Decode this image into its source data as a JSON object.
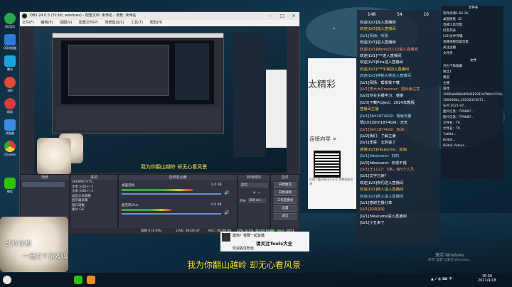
{
  "desktop": {
    "icons": [
      "QQ音乐",
      "QQ浏览器",
      "腾讯",
      "360",
      "网易",
      "浏览器",
      "Chrome",
      "微信"
    ]
  },
  "obs": {
    "title": "OBS 24.0.3 (32-bit, windows) - 配置文件: 未命名 - 场景: 未命名",
    "menu": [
      "文件(F)",
      "编辑(E)",
      "视图(V)",
      "配置文件(P)",
      "场景集合(S)",
      "工具(T)",
      "帮助(H)"
    ],
    "docks": {
      "scenes": "场景",
      "sources": "来源",
      "mixer": "音频混合器",
      "transitions": "转场特效",
      "controls": "控件"
    },
    "sources": [
      "3669967475...",
      "文本 (GDI+) 2",
      "文本 (GDI+) 2",
      "动态文本模板",
      "显示器采集",
      "窗口采集",
      "图片 GIF"
    ],
    "mixer": {
      "channel1": "桌面音频",
      "channel1_db": "0.0 dB",
      "channel2": "麦克风/Aux",
      "channel2_db": "0.0 dB"
    },
    "transition": {
      "type": "淡出",
      "duration_label": "时长",
      "duration": "300 ms"
    },
    "controls": [
      "开始推流",
      "开始录制",
      "工作室模式",
      "设置",
      "退出"
    ],
    "status": {
      "dropped": "丢帧 0 (0.0%)",
      "live": "LIVE: 00:00:37",
      "rec": "REC: 00:00:00",
      "cpu": "CPU: 8.5%, 60.00 fps",
      "kbps": "kb/s: 2651"
    },
    "preview_caption": "我为你翻山越岭 却无心看风景"
  },
  "chat": {
    "header": [
      "148",
      "54",
      "16"
    ],
    "lines": [
      "欢迎[LV2]加入直播间",
      "欢迎[LV3]加入直播间",
      "[LV1]风雨：听歌",
      "欢迎[LV3]进入直播间",
      "欢迎[LV1]Manny1122进入直播间",
      "欢迎[LV1]***进入直播间",
      "欢迎[LV3]Kira进入直播间",
      "欢迎[LV2]***平民加入直播间",
      "欢迎[LV3]神秘大佬进入直播间",
      "[LV1]风扬：帮帮我下载",
      "[LV1]李大大Dreamer：国际版注意",
      "[LV2]专业主播学习：感谢",
      "[LV3]下载Project：2024年教程",
      "直播间主播",
      "[LV1]Shh1874Gi9：我每天看",
      "赞[LV2]Shh1874Gi9：天天",
      "[LV1]Shh1874Gi9：加油",
      "[LV2]我们：了解主播",
      "[LV1]李哥：太厉害了",
      "感谢[LV3]hikukume：加油",
      "[LV1]hikukume：好的",
      "[LV2]hikukume：你很不错",
      "[LV1]王1122：5条，做5个人员",
      "[LV1]文字已读？",
      "欢迎[LV3]你们进入直播间",
      "欢迎[LV1]新人进入直播间",
      "欢迎[LV2]新人进入直播间",
      "[LV1]感谢主播分享",
      "[LV1]加油加油",
      "[LV1]hikukume进入直播间",
      "[LV1]小丑来了"
    ]
  },
  "right_panel": {
    "title1": "文件夹",
    "items1": [
      "软件资源1-02-26",
      "桌面壁纸（2）",
      "直播工具合集",
      "好友列表",
      "[V2]文件传输",
      "直播视频剪辑合集",
      "关注主播",
      "文件夹"
    ],
    "title2": "文件",
    "items2": [
      "点右下角收藏",
      "粉丝1",
      "赛道",
      "主播",
      "游戏",
      "1006ab66bb9f8d28291fa7984c57b0...",
      "1009468a_20210323071...",
      "乐点 2021-07...",
      "图片信息：TP9887...",
      "图片信息：TP9887...",
      "文件名：TP...",
      "文件名：TP...",
      "7a6dd...",
      "Bilibili...",
      "Bilibili Videos..."
    ]
  },
  "promo": {
    "headline": "太精彩",
    "link": "连接向导 >",
    "qr_caption": "扫描二维码关注公众号 免费获取资源"
  },
  "overlays": {
    "caption": "我为你翻山越岭 却无心看风景",
    "left_text1": "或许你想",
    "left_text2": "一起打个游戏吗",
    "popup_line1": "震惊！我要一起直播",
    "popup_line2": "请关注Tools大全",
    "popup_line3": "欢迎各位粉丝"
  },
  "watermark": {
    "line1": "激活 Windows",
    "line2": "转到\"设置\"以激活 Windows。"
  },
  "taskbar": {
    "time": "16:00",
    "date": "2021/4/18"
  }
}
